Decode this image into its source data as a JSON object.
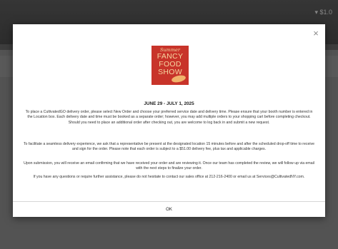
{
  "background": {
    "cart_text": "▾ $1.0"
  },
  "modal": {
    "close_glyph": "×",
    "logo": {
      "line1": "Summer",
      "line2": "FANCY",
      "line3": "FOOD",
      "line4": "SHOW"
    },
    "date": "JUNE 29 - JULY 1, 2025",
    "paragraphs": [
      "To place a CultivatedGO delivery order, please select New Order and choose your preferred service date and delivery time. Please ensure that your booth number is entered in the Location box. Each delivery date and time must be booked as a separate order; however, you may add multiple orders to your shopping cart before completing checkout. Should you need to place an additional order after checking out, you are welcome to log back in and submit a new request.",
      "To facilitate a seamless delivery experience, we ask that a representative be present at the designated location 15 minutes before and after the scheduled drop-off time to receive and sign for the order. Please note that each order is subject to a $51.00 delivery fee, plus tax and applicable charges.",
      "Upon submission, you will receive an email confirming that we have received your order and are reviewing it. Once our team has completed the review, we will follow up via email with the next steps to finalize your order.",
      "If you have any questions or require further assistance, please do not hesitate to contact our sales office at 212-216-2400 or email us at Services@CultivatedNY.com."
    ],
    "ok_label": "OK"
  },
  "colors": {
    "logo_red": "#c8342a",
    "backdrop": "#5b5b5b"
  }
}
